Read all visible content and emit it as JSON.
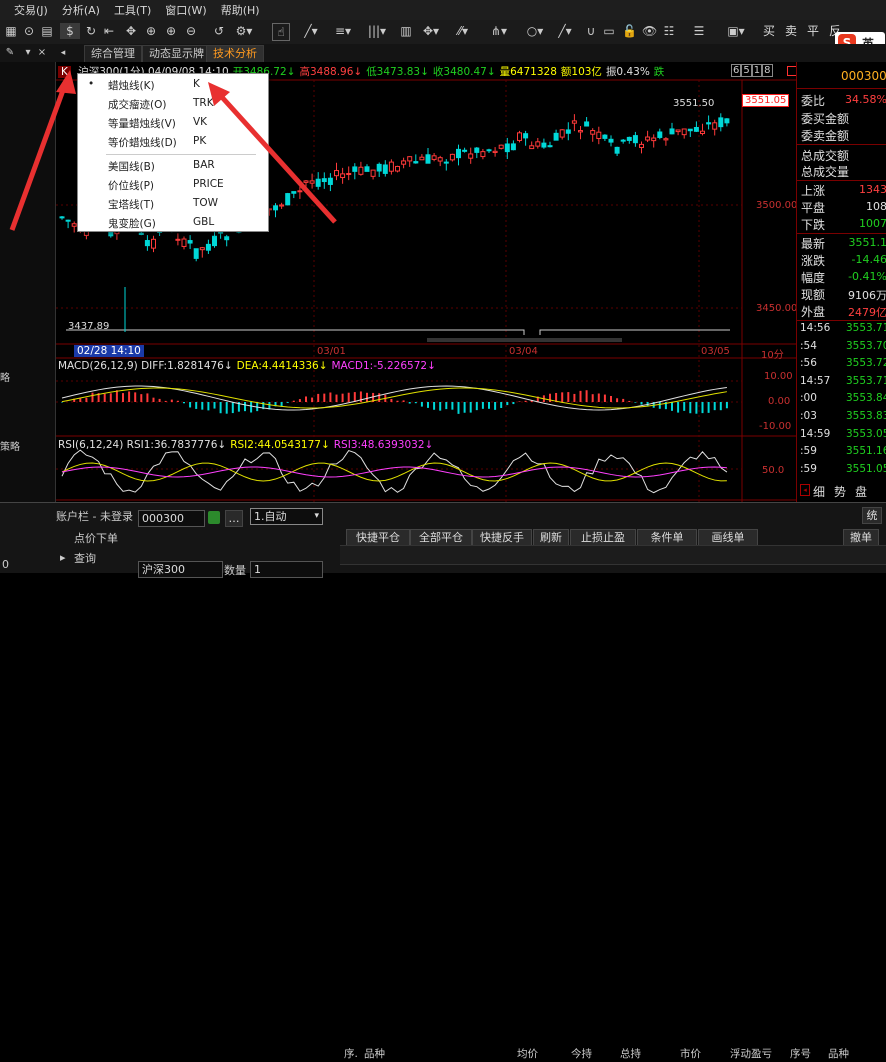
{
  "menubar": [
    "交易(J)",
    "分析(A)",
    "工具(T)",
    "窗口(W)",
    "帮助(H)"
  ],
  "toolbar_right": [
    "买",
    "卖",
    "平",
    "反"
  ],
  "ime": {
    "label": "英"
  },
  "tabs": [
    "综合管理",
    "动态显示牌",
    "技术分析"
  ],
  "active_tab": 2,
  "left_panel": {
    "items": [
      "略",
      "策略",
      "0"
    ]
  },
  "quote_bar": {
    "prefix": "K",
    "parts": [
      {
        "text": "沪深300(1分)  04/09/08 14:10",
        "color": "#e0e0e0"
      },
      {
        "text": "开3486.72↓",
        "color": "#20d020"
      },
      {
        "text": "高3488.96↓",
        "color": "#ff4040"
      },
      {
        "text": "低3473.83↓",
        "color": "#20d020"
      },
      {
        "text": "收3480.47↓",
        "color": "#20d020"
      },
      {
        "text": "量6471328",
        "color": "#ffff00"
      },
      {
        "text": "额103亿",
        "color": "#ffff00"
      },
      {
        "text": "振0.43%",
        "color": "#e0e0e0"
      },
      {
        "text": "跌",
        "color": "#20d020"
      }
    ],
    "right_boxes": [
      "6",
      "5",
      "1",
      "8"
    ]
  },
  "context_menu": {
    "items": [
      {
        "label": "蜡烛线(K)",
        "shortcut": "K",
        "checked": true
      },
      {
        "label": "成交瘤迹(O)",
        "shortcut": "TRK"
      },
      {
        "label": "等量蜡烛线(V)",
        "shortcut": "VK"
      },
      {
        "label": "等价蜡烛线(D)",
        "shortcut": "PK"
      },
      {
        "label": "美国线(B)",
        "shortcut": "BAR"
      },
      {
        "label": "价位线(P)",
        "shortcut": "PRICE"
      },
      {
        "label": "宝塔线(T)",
        "shortcut": "TOW"
      },
      {
        "label": "鬼变脸(G)",
        "shortcut": "GBL"
      }
    ]
  },
  "price_panel": {
    "y_labels": [
      "3551.05",
      "3500.00",
      "3450.00"
    ],
    "high_label": "3551.50",
    "low_label": "3437.89"
  },
  "x_axis": {
    "cursor_label": "02/28 14:10",
    "labels": [
      "03/01",
      "03/04",
      "03/05"
    ],
    "period": "10分"
  },
  "macd": {
    "title": "MACD(26,12,9)",
    "parts": [
      {
        "text": "DIFF:1.8281476↓",
        "color": "#e0e0e0"
      },
      {
        "text": "DEA:4.4414336↓",
        "color": "#ffff00"
      },
      {
        "text": "MACD1:-5.226572↓",
        "color": "#ff40ff"
      }
    ],
    "y_labels": [
      "10.00",
      "0.00",
      "-10.00"
    ]
  },
  "rsi": {
    "title": "RSI(6,12,24)",
    "parts": [
      {
        "text": "RSI1:36.7837776↓",
        "color": "#e0e0e0"
      },
      {
        "text": "RSI2:44.0543177↓",
        "color": "#ffff00"
      },
      {
        "text": "RSI3:48.6393032↓",
        "color": "#ff40ff"
      }
    ],
    "y_labels": [
      "50.0"
    ]
  },
  "right_panel": {
    "code": "000300",
    "wei_bi": {
      "label": "委比",
      "value": "34.58%"
    },
    "rows": [
      "委买金额",
      "委卖金额",
      "总成交额",
      "总成交量"
    ],
    "stats": [
      {
        "label": "上涨",
        "value": "1343",
        "color": "#ff4040"
      },
      {
        "label": "平盘",
        "value": "108",
        "color": "#e0e0e0"
      },
      {
        "label": "下跌",
        "value": "1007",
        "color": "#20d020"
      }
    ],
    "quote": [
      {
        "label": "最新",
        "value": "3551.1",
        "color": "#20d020"
      },
      {
        "label": "涨跌",
        "value": "-14.46",
        "color": "#20d020"
      },
      {
        "label": "幅度",
        "value": "-0.41%",
        "color": "#20d020"
      },
      {
        "label": "现额",
        "value": "9106万",
        "color": "#e0e0e0"
      },
      {
        "label": "外盘",
        "value": "2479亿",
        "color": "#ff4040"
      }
    ],
    "ticks": [
      {
        "t": "14:56",
        "p": "3553.71"
      },
      {
        "t": ":54",
        "p": "3553.70"
      },
      {
        "t": ":56",
        "p": "3553.72"
      },
      {
        "t": "14:57",
        "p": "3553.71"
      },
      {
        "t": ":00",
        "p": "3553.84"
      },
      {
        "t": ":03",
        "p": "3553.83"
      },
      {
        "t": "14:59",
        "p": "3553.05"
      },
      {
        "t": ":59",
        "p": "3551.16"
      },
      {
        "t": ":59",
        "p": "3551.05"
      }
    ],
    "footer": [
      "细",
      "势",
      "盘"
    ]
  },
  "bottom": {
    "title": "账户栏 - 未登录",
    "collapse": "统",
    "left_labels": [
      "点价下单",
      "查询",
      "0"
    ],
    "code_field": "000300",
    "auto_select": "1.自动",
    "name_field": "沪深300",
    "qty_label": "数量",
    "qty_value": "1",
    "buttons": [
      "快捷平仓",
      "全部平仓",
      "快捷反手",
      "刷新",
      "止损止盈",
      "条件单",
      "画线单"
    ],
    "cancel_button": "撤单",
    "headers_left": [
      "序.",
      "品种",
      "均价",
      "今持",
      "总持",
      "市价",
      "浮动盈亏"
    ],
    "headers_right": [
      "序号",
      "品种"
    ]
  }
}
